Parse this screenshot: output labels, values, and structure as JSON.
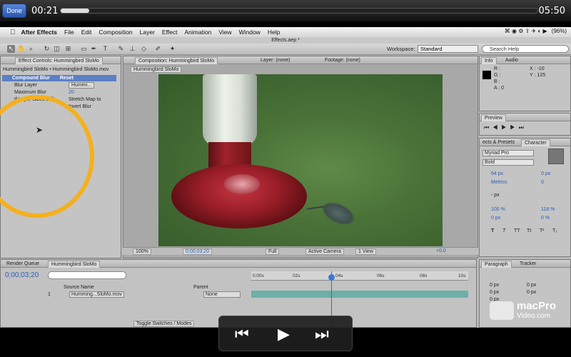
{
  "player": {
    "done_label": "Done",
    "elapsed": "00:21",
    "total": "05:50",
    "progress_fraction": 0.06
  },
  "menubar": {
    "app_name": "After Effects",
    "items": [
      "File",
      "Edit",
      "Composition",
      "Layer",
      "Effect",
      "Animation",
      "View",
      "Window",
      "Help"
    ],
    "battery": "(96%)",
    "right_icons": "⌘ ◉ ⚙ ⇪ ✈ ◐ ▶"
  },
  "window_title": "Effects.aep *",
  "toolbar": {
    "workspace_label": "Workspace:",
    "workspace_value": "Standard",
    "search_placeholder": "Search Help"
  },
  "effect_controls": {
    "tab_label": "Effect Controls: Hummingbird SloMo",
    "breadcrumb": "Hummingbird SloMo • Hummingbird SloMo.mov",
    "effect_name": "Compound Blur",
    "reset_label": "Reset",
    "blur_layer_label": "Blur Layer",
    "blur_layer_value": "Hummi...",
    "max_blur_label": "Maximum Blur",
    "max_blur_value": "20",
    "if_layer_sizes_label": "If Layer Sizes Diff",
    "stretch_map_label": "Stretch Map to",
    "invert_blur_label": "Invert Blur"
  },
  "composition": {
    "tab_label": "Composition: Hummingbird SloMo",
    "layer_tab": "Layer: (none)",
    "footage_tab": "Footage: (none)",
    "sub_tab": "Hummingbird SloMo",
    "zoom": "100%",
    "timecode": "0;00;03;20",
    "resolution": "Full",
    "camera": "Active Camera",
    "views": "1 View",
    "exposure": "+0.0"
  },
  "info_panel": {
    "tab_info": "Info",
    "tab_audio": "Audio",
    "r": "R :",
    "g": "G :",
    "b": "B :",
    "a": "A : 0",
    "x": "X : -10",
    "y": "Y : 125"
  },
  "preview_panel": {
    "tab_label": "Preview"
  },
  "effects_presets": {
    "tab_label": "ects & Presets"
  },
  "character_panel": {
    "tab_label": "Character",
    "font": "Myriad Pro",
    "style": "Bold",
    "size": "64 px",
    "leading": "0 px",
    "kerning": "Metrics",
    "tracking": "0",
    "stroke": "- px",
    "vscale": "100 %",
    "hscale": "118 %",
    "baseline": "0 px",
    "tsume": "0 %",
    "format_buttons": [
      "T",
      "T",
      "TT",
      "Tt",
      "T¹",
      "T₁"
    ]
  },
  "paragraph_panel": {
    "tab_label": "Paragraph",
    "tab_tracker": "Tracker",
    "values": [
      "0 px",
      "0 px",
      "0 px",
      "0 px",
      "0 px"
    ]
  },
  "timeline": {
    "tab_render": "Render Queue",
    "tab_comp": "Hummingbird SloMo",
    "timecode": "0;00;03;20",
    "search_placeholder": "",
    "source_name_header": "Source Name",
    "parent_header": "Parent",
    "layer_number": "1",
    "layer_name": "Humming...SloMo.mov",
    "parent_value": "None",
    "toggle_label": "Toggle Switches / Modes",
    "ruler_ticks": [
      "0;00s",
      "02s",
      "04s",
      "06s",
      "08s",
      "10s"
    ]
  },
  "watermark": {
    "line1": "macPro",
    "line2": "Video.com"
  }
}
